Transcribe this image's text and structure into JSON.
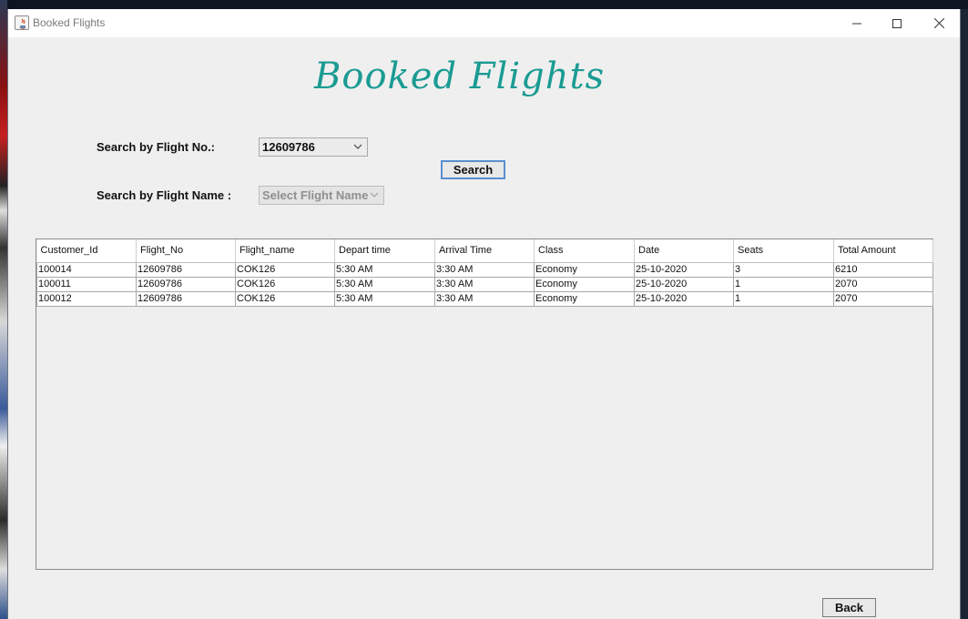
{
  "window": {
    "title": "Booked Flights"
  },
  "heading": "Booked Flights",
  "search": {
    "flight_no_label": "Search by Flight No.:",
    "flight_no_value": "12609786",
    "flight_name_label": "Search by Flight Name :",
    "flight_name_value": "Select Flight Name",
    "search_button": "Search"
  },
  "table": {
    "columns": [
      "Customer_Id",
      "Flight_No",
      "Flight_name",
      "Depart time",
      "Arrival Time",
      "Class",
      "Date",
      "Seats",
      "Total Amount"
    ],
    "rows": [
      [
        "100014",
        "12609786",
        "COK126",
        "5:30 AM",
        "3:30 AM",
        "Economy",
        "25-10-2020",
        "3",
        "6210"
      ],
      [
        "100011",
        "12609786",
        "COK126",
        "5:30 AM",
        "3:30 AM",
        "Economy",
        "25-10-2020",
        "1",
        "2070"
      ],
      [
        "100012",
        "12609786",
        "COK126",
        "5:30 AM",
        "3:30 AM",
        "Economy",
        "25-10-2020",
        "1",
        "2070"
      ]
    ]
  },
  "back_button": "Back",
  "colors": {
    "heading": "#1a9b93",
    "search_focus": "#5a8fd0"
  }
}
